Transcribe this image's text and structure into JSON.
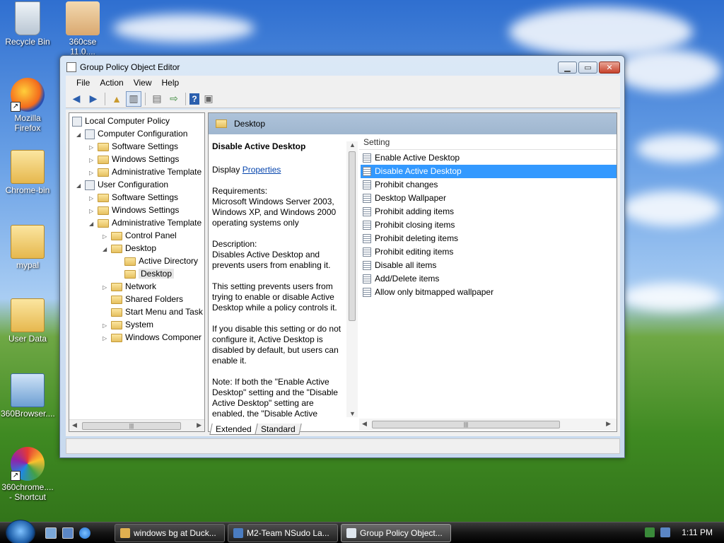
{
  "desktop": {
    "icons": [
      {
        "label": "Recycle Bin"
      },
      {
        "label": "360cse 11.0...."
      },
      {
        "label": "Mozilla Firefox"
      },
      {
        "label": "Chrome-bin"
      },
      {
        "label": "mypal"
      },
      {
        "label": "User Data"
      },
      {
        "label": "360Browser...."
      },
      {
        "label": "360chrome.... - Shortcut"
      }
    ]
  },
  "window": {
    "title": "Group Policy Object Editor",
    "menu": [
      "File",
      "Action",
      "View",
      "Help"
    ],
    "tree": {
      "root": "Local Computer Policy",
      "computer_config": "Computer Configuration",
      "cc_software": "Software Settings",
      "cc_windows": "Windows Settings",
      "cc_admin": "Administrative Template",
      "user_config": "User Configuration",
      "uc_software": "Software Settings",
      "uc_windows": "Windows Settings",
      "uc_admin": "Administrative Template",
      "control_panel": "Control Panel",
      "desktop": "Desktop",
      "active_directory": "Active Directory",
      "desktop_sub": "Desktop",
      "network": "Network",
      "shared_folders": "Shared Folders",
      "start_menu": "Start Menu and Task",
      "system": "System",
      "windows_components": "Windows Componer"
    },
    "pane_header": "Desktop",
    "description": {
      "title": "Disable Active Desktop",
      "display_prefix": "Display",
      "display_link": "Properties",
      "requirements_label": "Requirements:",
      "requirements": "Microsoft Windows Server 2003, Windows XP, and Windows 2000 operating systems only",
      "description_label": "Description:",
      "description": "Disables Active Desktop and prevents users from enabling it.",
      "para1": "This setting prevents users from trying to enable or disable Active Desktop while a policy controls it.",
      "para2": "If you disable this setting or do not configure it, Active Desktop is disabled by default, but users can enable it.",
      "para3": "Note: If both the \"Enable Active Desktop\" setting and the \"Disable Active Desktop\" setting are enabled, the \"Disable Active"
    },
    "list_header": "Setting",
    "settings": [
      "Enable Active Desktop",
      "Disable Active Desktop",
      "Prohibit changes",
      "Desktop Wallpaper",
      "Prohibit adding items",
      "Prohibit closing items",
      "Prohibit deleting items",
      "Prohibit editing items",
      "Disable all items",
      "Add/Delete items",
      "Allow only bitmapped wallpaper"
    ],
    "tabs": [
      "Extended",
      "Standard"
    ]
  },
  "taskbar": {
    "tasks": [
      "windows bg at Duck...",
      "M2-Team NSudo La...",
      "Group Policy Object..."
    ],
    "clock": "1:11 PM"
  }
}
